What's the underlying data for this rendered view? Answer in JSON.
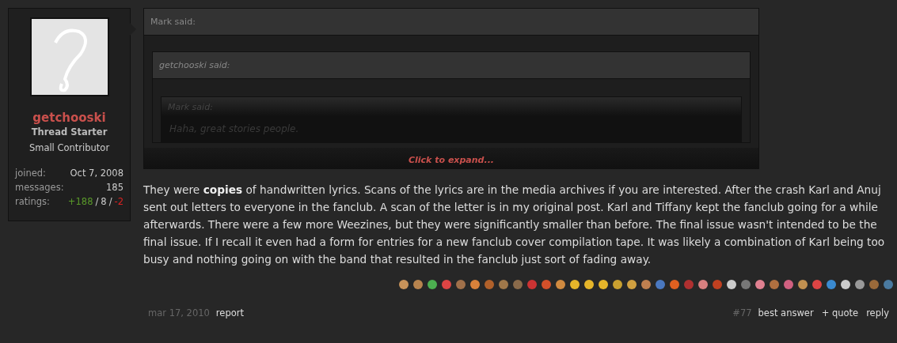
{
  "user": {
    "name": "getchooski",
    "badge": "Thread Starter",
    "rank": "Small Contributor",
    "stats": [
      {
        "label": "joined:",
        "value": "Oct 7, 2008"
      },
      {
        "label": "messages:",
        "value": "185"
      }
    ],
    "ratings": {
      "label": "ratings:",
      "positive": "+188",
      "neutral": "8",
      "negative": "-2",
      "separator": "/"
    }
  },
  "quote": {
    "author": "Mark said:",
    "nested": {
      "author": "getchooski said:",
      "nested": {
        "author": "Mark said:",
        "text": "Haha, great stories people."
      }
    },
    "expand": "Click to expand..."
  },
  "body": "They were **copies** of handwritten lyrics. Scans of the lyrics are in the media archives if you are interested. After the crash Karl and Anuj sent out letters to everyone in the fanclub. A scan of the letter is in my original post. Karl and Tiffany kept the fanclub going for a while afterwards. There were a few more Weezines, but they were significantly smaller than before. The final issue wasn't intended to be the final issue. If I recall it even had a form for entries for a new fanclub cover compilation tape. It was likely a combination of Karl being too busy and nothing going on with the band that resulted in the fanclub just sort of fading away.",
  "footer": {
    "date": "mar 17, 2010",
    "report": "report",
    "number": "#77",
    "actions": [
      "best answer",
      "+ quote",
      "reply"
    ]
  }
}
